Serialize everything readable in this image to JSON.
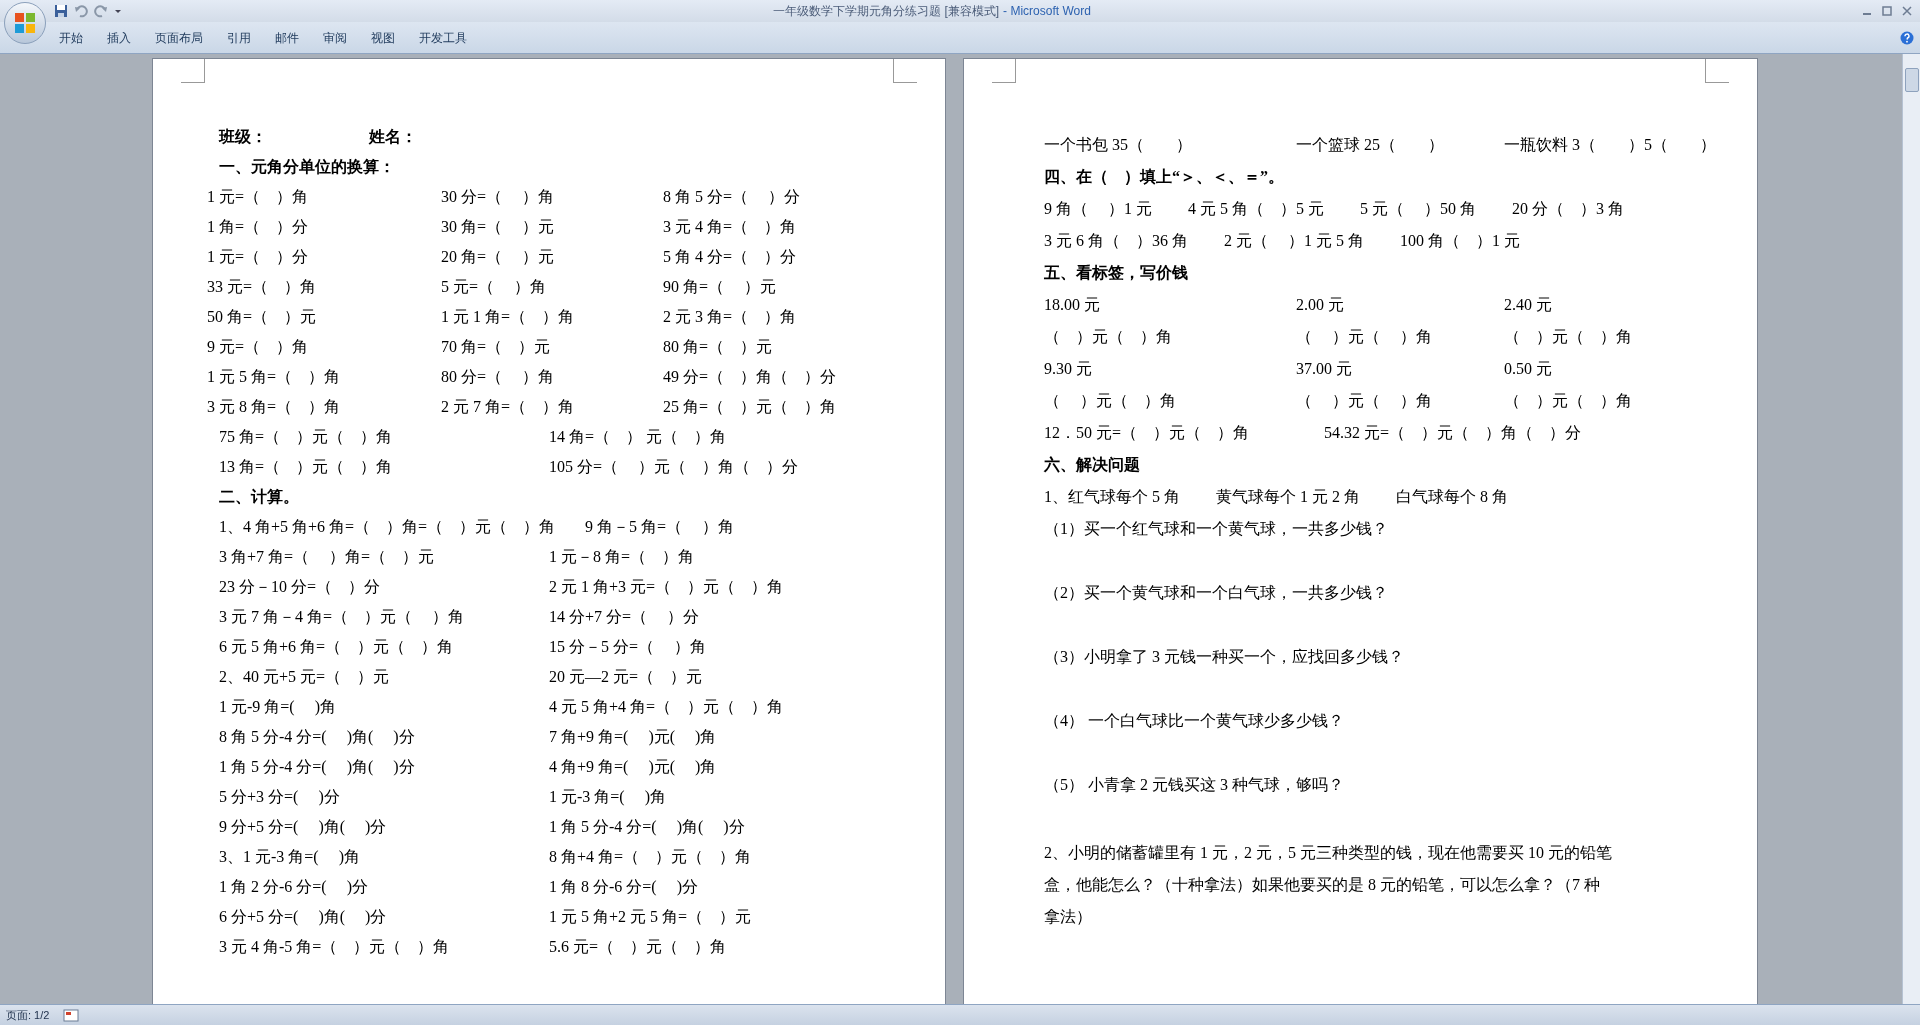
{
  "window": {
    "title": "一年级数学下学期元角分练习题 [兼容模式]",
    "app": "- Microsoft Word"
  },
  "ribbon_tabs": [
    {
      "label": "开始"
    },
    {
      "label": "插入"
    },
    {
      "label": "页面布局"
    },
    {
      "label": "引用"
    },
    {
      "label": "邮件"
    },
    {
      "label": "审阅"
    },
    {
      "label": "视图"
    },
    {
      "label": "开发工具"
    }
  ],
  "left_page": [
    {
      "kind": "header",
      "cells": [
        "班级：",
        "姓名："
      ]
    },
    {
      "kind": "heading",
      "text": "一、元角分单位的换算："
    },
    {
      "kind": "row",
      "cells": [
        "1 元=（　）角",
        "30 分=（　 ）角",
        "8 角 5 分=（　 ）分"
      ]
    },
    {
      "kind": "row",
      "cells": [
        "1 角=（　）分",
        "30 角=（　 ）元",
        "3 元 4 角=（　）角"
      ]
    },
    {
      "kind": "row",
      "cells": [
        "1 元=（　）分",
        "20 角=（　 ）元",
        "5 角 4 分=（　）分"
      ]
    },
    {
      "kind": "row",
      "cells": [
        "33 元=（　）角",
        "5 元=（　 ）角",
        "90 角=（　 ）元"
      ]
    },
    {
      "kind": "row",
      "cells": [
        "50 角=（　）元",
        "1 元 1 角=（　）角",
        "2 元 3 角=（　）角"
      ]
    },
    {
      "kind": "row",
      "cells": [
        "9 元=（　）角",
        "70 角=（　）元",
        "80 角=（　）元"
      ]
    },
    {
      "kind": "row",
      "cells": [
        "1 元 5 角=（　）角",
        "80 分=（　 ）角",
        "49 分=（　）角（　）分"
      ]
    },
    {
      "kind": "row",
      "cells": [
        "3 元 8 角=（　）角",
        "2 元 7 角=（　）角",
        "25 角=（　）元（　）角"
      ]
    },
    {
      "kind": "row",
      "cells": [
        "75 角=（　）元（　）角",
        "14 角=（　） 元（　）角"
      ]
    },
    {
      "kind": "row",
      "cells": [
        "13 角=（　）元（　）角",
        "105 分=（　 ）元（　）角（　）分"
      ]
    },
    {
      "kind": "heading",
      "text": "二、计算。"
    },
    {
      "kind": "row",
      "cells": [
        "1、4 角+5 角+6 角=（　）角=（　）元（　）角",
        "9 角－5 角=（　 ）角"
      ]
    },
    {
      "kind": "row",
      "cells": [
        "3 角+7 角=（　 ）角=（　）元",
        "1 元－8 角=（　）角"
      ]
    },
    {
      "kind": "row",
      "cells": [
        "23 分－10 分=（　）分",
        "2 元 1 角+3 元=（　）元（　）角"
      ]
    },
    {
      "kind": "row",
      "cells": [
        "3 元 7 角－4 角=（　）元（　 ）角",
        "14 分+7 分=（　 ）分"
      ]
    },
    {
      "kind": "row",
      "cells": [
        "6 元 5 角+6 角=（　）元（　）角",
        "15 分－5 分=（　 ）角"
      ]
    },
    {
      "kind": "row",
      "cells": [
        "2、40 元+5 元=（　）元",
        "20 元—2 元=（　）元"
      ]
    },
    {
      "kind": "row",
      "cells": [
        "1 元-9 角=(　 )角",
        "4 元 5 角+4 角=（　）元（　）角"
      ]
    },
    {
      "kind": "row",
      "cells": [
        "8 角 5 分-4 分=(　 )角(　 )分",
        "7 角+9 角=(　 )元(　 )角"
      ]
    },
    {
      "kind": "row",
      "cells": [
        "1 角 5 分-4 分=(　 )角(　 )分",
        "4 角+9 角=(　 )元(　 )角"
      ]
    },
    {
      "kind": "row",
      "cells": [
        "5 分+3 分=(　 )分",
        "1 元-3 角=(　 )角"
      ]
    },
    {
      "kind": "row",
      "cells": [
        "9 分+5 分=(　 )角(　 )分",
        "1 角 5 分-4 分=(　 )角(　 )分"
      ]
    },
    {
      "kind": "row",
      "cells": [
        "3、1 元-3 角=(　 )角",
        "8 角+4 角=（　）元（　）角"
      ]
    },
    {
      "kind": "row",
      "cells": [
        "1 角 2 分-6 分=(　 )分",
        "1 角 8 分-6 分=(　 )分"
      ]
    },
    {
      "kind": "row",
      "cells": [
        "6 分+5 分=(　 )角(　 )分",
        "1 元 5 角+2 元 5 角=（　）元"
      ]
    },
    {
      "kind": "row",
      "cells": [
        "3 元 4 角-5 角=（　）元（　）角",
        "5.6 元=（　）元（　）角"
      ]
    }
  ],
  "right_page": [
    {
      "kind": "row",
      "cells": [
        "一个书包 35（　　）",
        "一个篮球 25（　　）",
        "一瓶饮料 3（　　）5（　　）"
      ]
    },
    {
      "kind": "heading",
      "text": "四、在（　）填上“＞、＜、＝”。"
    },
    {
      "kind": "line",
      "cells": [
        "9 角（　 ）1 元",
        "4 元 5 角（　）5 元",
        "5 元（　 ）50 角",
        "20 分（　）3 角"
      ]
    },
    {
      "kind": "line",
      "cells": [
        "3 元 6 角（　）36 角",
        "2 元（　 ）1 元 5 角",
        "100 角（　）1 元"
      ]
    },
    {
      "kind": "heading",
      "text": "五、看标签，写价钱"
    },
    {
      "kind": "row",
      "cells": [
        "18.00 元",
        "2.00 元",
        "2.40 元"
      ]
    },
    {
      "kind": "row",
      "cells": [
        "（　）元（　）角",
        "（　 ）元（　 ）角",
        "（　）元（　）角"
      ]
    },
    {
      "kind": "row",
      "cells": [
        "9.30 元",
        "37.00 元",
        "0.50 元"
      ]
    },
    {
      "kind": "row",
      "cells": [
        "（　 ）元（　）角",
        "（　 ）元（　 ）角",
        "（　）元（　）角"
      ]
    },
    {
      "kind": "row",
      "cells": [
        "12．50 元=（　）元（　）角",
        "54.32 元=（　）元（　）角（　）分"
      ]
    },
    {
      "kind": "heading",
      "text": "六、解决问题"
    },
    {
      "kind": "line",
      "cells": [
        "1、红气球每个 5 角",
        "黄气球每个 1 元 2 角",
        "白气球每个 8 角"
      ]
    },
    {
      "kind": "question",
      "text": "（1）买一个红气球和一个黄气球，一共多少钱？"
    },
    {
      "kind": "question",
      "text": "（2）买一个黄气球和一个白气球，一共多少钱？"
    },
    {
      "kind": "question",
      "text": "（3）小明拿了 3 元钱一种买一个，应找回多少钱？"
    },
    {
      "kind": "question",
      "text": "（4） 一个白气球比一个黄气球少多少钱？"
    },
    {
      "kind": "question",
      "text": "（5） 小青拿 2 元钱买这 3 种气球，够吗？"
    },
    {
      "kind": "para",
      "text": "2、小明的储蓄罐里有 1 元，2 元，5 元三种类型的钱，现在他需要买 10 元的铅笔盒，他能怎么？（十种拿法）如果他要买的是 8 元的铅笔，可以怎么拿？（7 种拿法）"
    }
  ],
  "status_bar": {
    "page": "页面: 1/2"
  }
}
